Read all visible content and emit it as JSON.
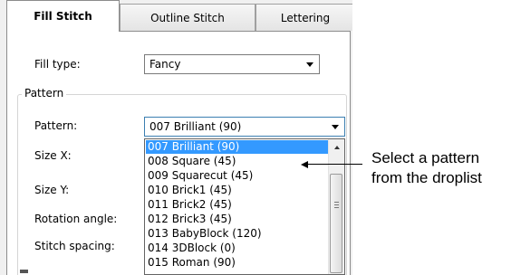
{
  "tabs": [
    {
      "label": "Fill Stitch",
      "active": true
    },
    {
      "label": "Outline Stitch",
      "active": false
    },
    {
      "label": "Lettering",
      "active": false
    }
  ],
  "fill_type": {
    "label": "Fill type:",
    "value": "Fancy"
  },
  "pattern_group": {
    "title": "Pattern"
  },
  "pattern": {
    "label": "Pattern:",
    "value": "007 Brilliant (90)"
  },
  "fields": [
    {
      "label": "Size X:"
    },
    {
      "label": "Size Y:"
    },
    {
      "label": "Rotation angle:"
    },
    {
      "label": "Stitch spacing:"
    }
  ],
  "dropdown_items": [
    {
      "label": "007 Brilliant (90)",
      "selected": true
    },
    {
      "label": "008 Square (45)",
      "selected": false
    },
    {
      "label": "009 Squarecut (45)",
      "selected": false
    },
    {
      "label": "010 Brick1 (45)",
      "selected": false
    },
    {
      "label": "011 Brick2 (45)",
      "selected": false
    },
    {
      "label": "012 Brick3 (45)",
      "selected": false
    },
    {
      "label": "013 BabyBlock (120)",
      "selected": false
    },
    {
      "label": "014 3DBlock (0)",
      "selected": false
    },
    {
      "label": "015 Roman (90)",
      "selected": false
    }
  ],
  "callout": {
    "line1": "Select a pattern",
    "line2": "from the droplist"
  },
  "colors": {
    "selection": "#3399ff",
    "panel_bg": "#ffffff",
    "dialog_bg": "#f0f0f0"
  }
}
